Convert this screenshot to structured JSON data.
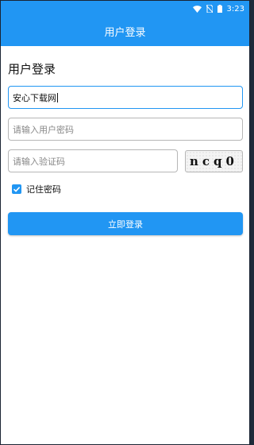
{
  "status_bar": {
    "time": "3:23"
  },
  "app_bar": {
    "title": "用户登录"
  },
  "form": {
    "heading": "用户登录",
    "username": {
      "value": "安心下载网"
    },
    "password": {
      "placeholder": "请输入用户密码"
    },
    "captcha": {
      "placeholder": "请输入验证码",
      "image_text": "ncq0"
    },
    "remember": {
      "label": "记住密码",
      "checked": true
    },
    "submit_label": "立即登录"
  },
  "colors": {
    "primary": "#2196f3",
    "border": "#b6b6b6"
  },
  "icons": [
    "wifi-icon",
    "no-sim-icon",
    "battery-icon",
    "checkmark-icon"
  ]
}
